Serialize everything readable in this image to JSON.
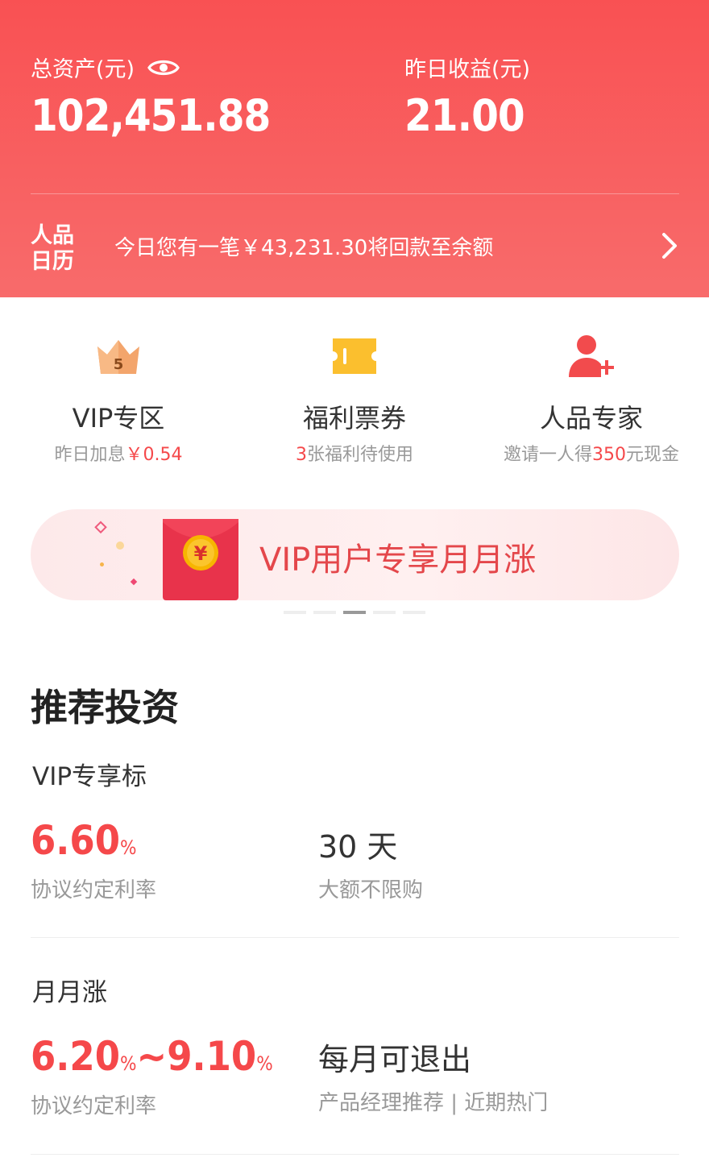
{
  "header": {
    "total_assets_label": "总资产(元)",
    "total_assets_value": "102,451.88",
    "yesterday_income_label": "昨日收益(元)",
    "yesterday_income_value": "21.00",
    "calendar_logo_text_top": "人品",
    "calendar_logo_text_bottom": "日历",
    "calendar_message": "今日您有一笔￥43,231.30将回款至余额"
  },
  "entries": [
    {
      "title": "VIP专区",
      "sub_prefix": "昨日加息",
      "sub_highlight": "￥0.54",
      "sub_suffix": "",
      "icon": "crown-icon",
      "badge": "5"
    },
    {
      "title": "福利票券",
      "sub_prefix": "",
      "sub_highlight": "3",
      "sub_suffix": "张福利待使用",
      "icon": "ticket-icon"
    },
    {
      "title": "人品专家",
      "sub_prefix": "邀请一人得",
      "sub_highlight": "350",
      "sub_suffix": "元现金",
      "icon": "add-user-icon"
    }
  ],
  "banner": {
    "text": "VIP用户专享月月涨",
    "coin_symbol": "¥",
    "active_index": 2,
    "count": 5
  },
  "recommend": {
    "title": "推荐投资",
    "products": [
      {
        "tag": "VIP专享标",
        "rate": "6.60",
        "rate_unit": "%",
        "rate_label": "协议约定利率",
        "term": "30 天",
        "term_label": "大额不限购"
      },
      {
        "tag": "月月涨",
        "rate_low": "6.20",
        "rate_high": "9.10",
        "rate_unit": "%",
        "rate_sep": "~",
        "rate_label": "协议约定利率",
        "term": "每月可退出",
        "term_label": "产品经理推荐 | 近期热门"
      }
    ]
  },
  "colors": {
    "header_red": "#f95153",
    "accent_red": "#f5484a",
    "ticket_yellow": "#fbbf2e",
    "tag_highlight": "#fdeeb3"
  }
}
